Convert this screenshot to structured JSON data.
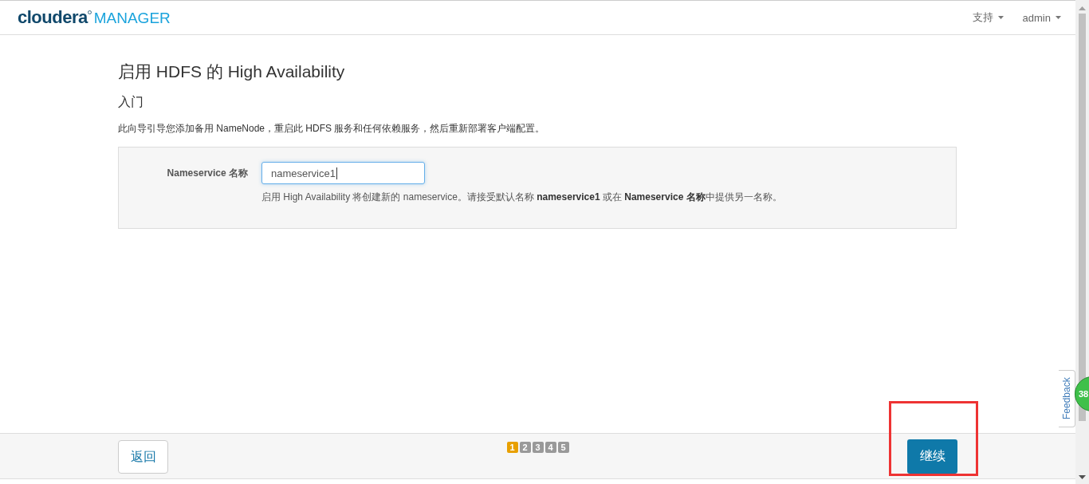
{
  "header": {
    "logo_word": "cloudera",
    "logo_product": "MANAGER",
    "menus": [
      {
        "label": "支持"
      },
      {
        "label": "admin"
      }
    ]
  },
  "page": {
    "title": "启用 HDFS 的 High Availability",
    "subtitle": "入门",
    "intro": "此向导引导您添加备用 NameNode，重启此 HDFS 服务和任何依赖服务，然后重新部署客户端配置。"
  },
  "form": {
    "label": "Nameservice 名称",
    "value": "nameservice1",
    "help": "启用 High Availability 将创建新的 nameservice。请接受默认名称 **nameservice1** 或在 **Nameservice 名称**中提供另一名称。"
  },
  "footer": {
    "back": "返回",
    "continue": "继续",
    "steps": [
      {
        "label": "1",
        "selected": true
      },
      {
        "label": "2",
        "selected": false
      },
      {
        "label": "3",
        "selected": false
      },
      {
        "label": "4",
        "selected": false
      },
      {
        "label": "5",
        "selected": false
      }
    ]
  },
  "feedback": "Feedback",
  "badge": "38"
}
